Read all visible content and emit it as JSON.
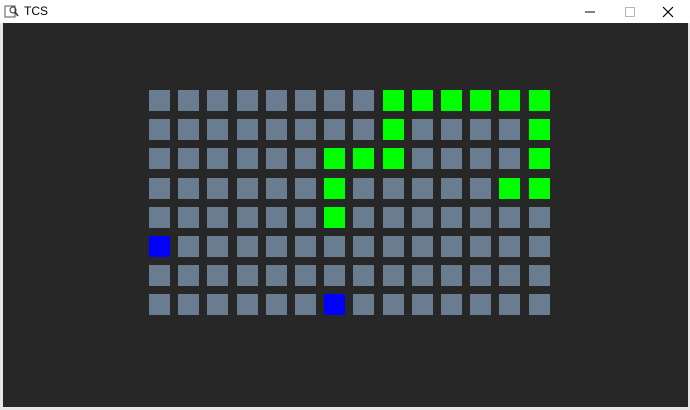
{
  "window": {
    "title": "TCS",
    "controls": {
      "minimize_icon": "minimize-icon",
      "maximize_icon": "maximize-icon",
      "close_icon": "close-icon"
    }
  },
  "colors": {
    "background": "#272727",
    "empty_cell": "#6a7d90",
    "snake": "#00ff00",
    "food": "#0000ff"
  },
  "grid": {
    "columns": 14,
    "rows": 8,
    "snake_cells": [
      [
        4,
        6
      ],
      [
        3,
        6
      ],
      [
        2,
        6
      ],
      [
        2,
        7
      ],
      [
        2,
        8
      ],
      [
        1,
        8
      ],
      [
        0,
        8
      ],
      [
        0,
        9
      ],
      [
        0,
        10
      ],
      [
        0,
        11
      ],
      [
        0,
        12
      ],
      [
        0,
        13
      ],
      [
        1,
        13
      ],
      [
        2,
        13
      ],
      [
        3,
        13
      ],
      [
        3,
        12
      ]
    ],
    "food_cells": [
      [
        5,
        0
      ],
      [
        7,
        6
      ]
    ]
  }
}
